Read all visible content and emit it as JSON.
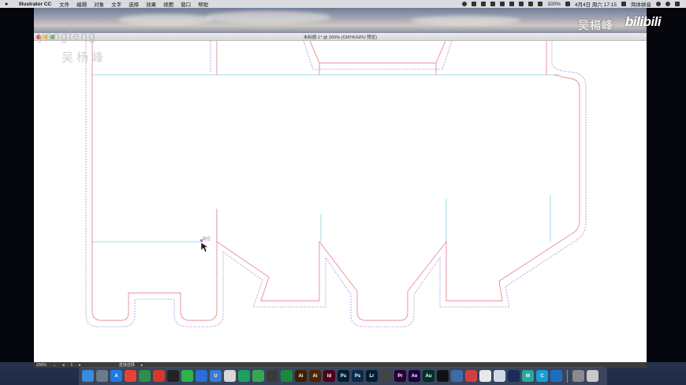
{
  "menubar": {
    "app_name": "Illustrator CC",
    "items": [
      "文件",
      "编辑",
      "对象",
      "文字",
      "选择",
      "效果",
      "视图",
      "窗口",
      "帮助"
    ],
    "battery": "100%",
    "datetime": "4月4日 周六 17:15",
    "input_method": "简体拼音"
  },
  "window": {
    "title": "未标题-1* @ 200% (CMYK/GPU 预览)"
  },
  "watermark": {
    "en": "yangfeng",
    "cn": "吴杨峰"
  },
  "canvas": {
    "tooltip": "路径"
  },
  "statusbar": {
    "zoom": "200%",
    "artboard": "1",
    "tool": "直接选择"
  },
  "overlay": {
    "streamer": "吴楊峰",
    "brand": "bilibili"
  },
  "dock": {
    "apps": [
      {
        "name": "finder",
        "label": "",
        "color": "#3b8bdb"
      },
      {
        "name": "launchpad",
        "label": "",
        "color": "#6c7a8c"
      },
      {
        "name": "app-store",
        "label": "A",
        "color": "#1c7ce0"
      },
      {
        "name": "chrome",
        "label": "",
        "color": "#e94235"
      },
      {
        "name": "browser",
        "label": "",
        "color": "#2f8f4a"
      },
      {
        "name": "weibo",
        "label": "",
        "color": "#d13a2a"
      },
      {
        "name": "qq",
        "label": "",
        "color": "#222222"
      },
      {
        "name": "wechat",
        "label": "",
        "color": "#2db34a"
      },
      {
        "name": "baidu",
        "label": "",
        "color": "#2a6ed6"
      },
      {
        "name": "utool",
        "label": "U",
        "color": "#3a7ad6"
      },
      {
        "name": "infuse",
        "label": "",
        "color": "#d8d8d8"
      },
      {
        "name": "wechat-mini",
        "label": "",
        "color": "#1aa260"
      },
      {
        "name": "evernote",
        "label": "",
        "color": "#37a852"
      },
      {
        "name": "teams",
        "label": "",
        "color": "#3a3a3a"
      },
      {
        "name": "tool",
        "label": "",
        "color": "#1a8a3a"
      },
      {
        "name": "ai-1",
        "label": "Ai",
        "color": "#3d1f00"
      },
      {
        "name": "ai-2",
        "label": "Ai",
        "color": "#4b2600"
      },
      {
        "name": "id",
        "label": "Id",
        "color": "#49021f"
      },
      {
        "name": "ps-1",
        "label": "Ps",
        "color": "#001d34"
      },
      {
        "name": "ps-2",
        "label": "Ps",
        "color": "#0a2a4a"
      },
      {
        "name": "lr",
        "label": "Lr",
        "color": "#001d34"
      },
      {
        "name": "clapper",
        "label": "",
        "color": "#444"
      },
      {
        "name": "pr",
        "label": "Pr",
        "color": "#2a0034"
      },
      {
        "name": "ae",
        "label": "Ae",
        "color": "#1a0040"
      },
      {
        "name": "au",
        "label": "Au",
        "color": "#00302c"
      },
      {
        "name": "c4d",
        "label": "",
        "color": "#111"
      },
      {
        "name": "blender",
        "label": "",
        "color": "#3b6ea8"
      },
      {
        "name": "sketch-app",
        "label": "",
        "color": "#d04040"
      },
      {
        "name": "zbrush",
        "label": "",
        "color": "#e8e8e8"
      },
      {
        "name": "bird",
        "label": "",
        "color": "#cfd8e4"
      },
      {
        "name": "steam",
        "label": "",
        "color": "#1a2a5a"
      },
      {
        "name": "m-app",
        "label": "M",
        "color": "#2aa89a"
      },
      {
        "name": "c-app",
        "label": "C",
        "color": "#1a9ed8"
      },
      {
        "name": "edge",
        "label": "",
        "color": "#1a70c0"
      },
      {
        "name": "folder",
        "label": "",
        "color": "#8b8b8b"
      },
      {
        "name": "trash",
        "label": "",
        "color": "#c8c8c8"
      }
    ]
  },
  "colors": {
    "cut_line": "#e88a9c",
    "bleed_line": "#9a78d6",
    "guide_line": "#7fd3e0"
  }
}
